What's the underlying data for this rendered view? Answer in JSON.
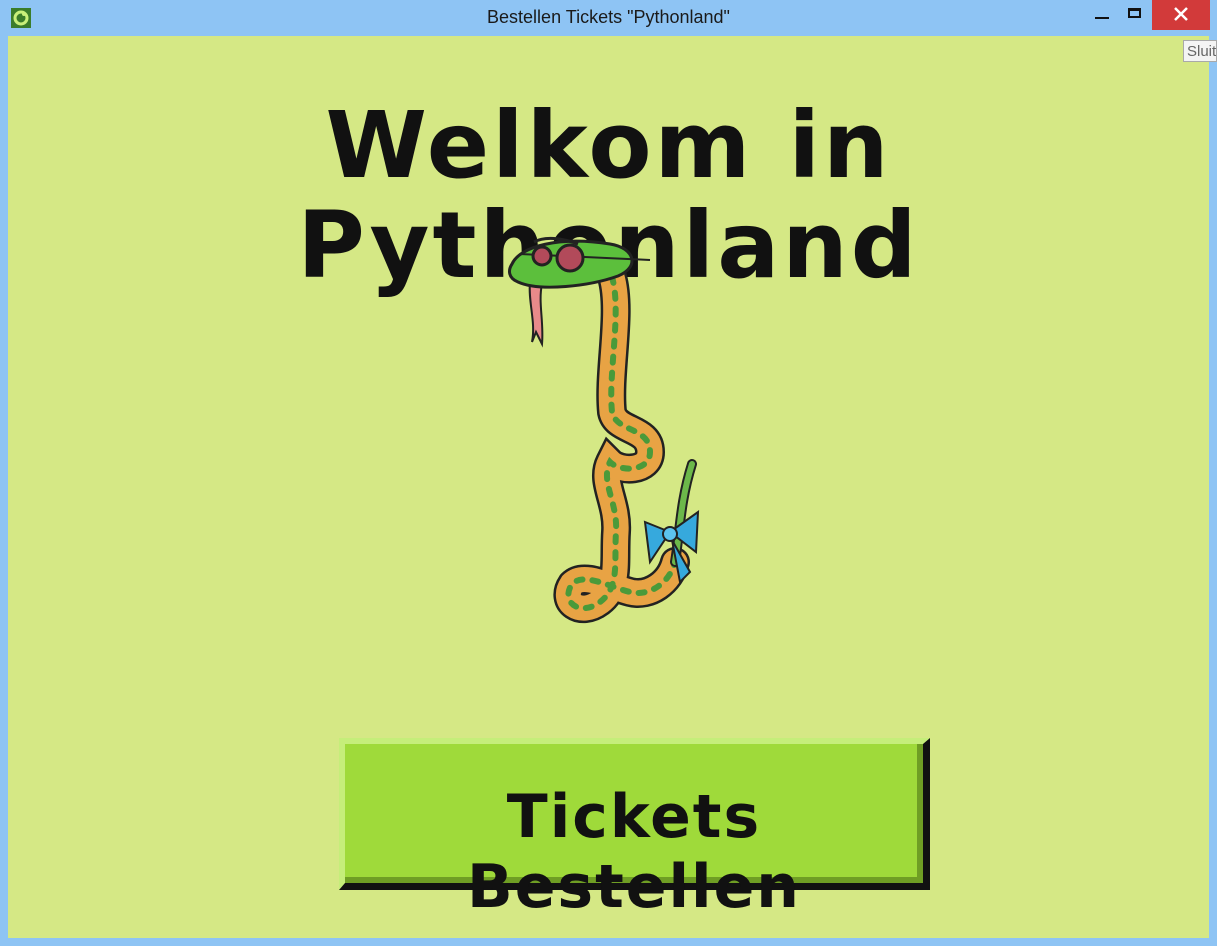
{
  "window": {
    "title": "Bestellen Tickets \"Pythonland\"",
    "tooltip": "Sluiten"
  },
  "main": {
    "heading": "Welkom in Pythonland",
    "order_button_label": "Tickets Bestellen"
  },
  "colors": {
    "background": "#d5e885",
    "button": "#9fda3a",
    "close_button": "#d23a3a"
  },
  "icons": {
    "app": "python-app-icon",
    "illustration": "snake-illustration"
  }
}
